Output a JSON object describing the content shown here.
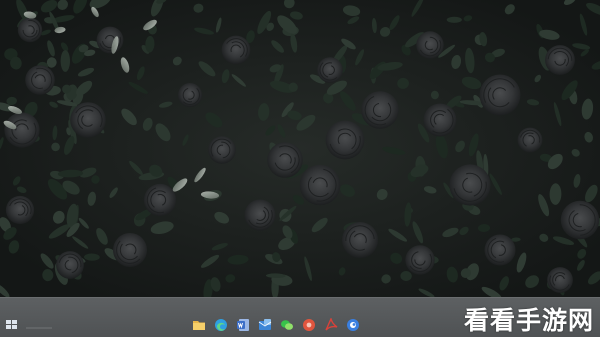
{
  "desktop": {
    "wallpaper": "dark-roses",
    "colors": {
      "foliage": "#2c3430",
      "petal": "#3a3c3e",
      "leaf_highlight": "#9aa39c",
      "taskbar": "#57595b"
    }
  },
  "taskbar": {
    "start_icon": "windows-start-icon",
    "apps": [
      {
        "name": "file-explorer",
        "icon": "folder-icon",
        "color": "#e8b64a"
      },
      {
        "name": "edge",
        "icon": "edge-icon",
        "color": "#2f9fe0"
      },
      {
        "name": "word",
        "icon": "word-icon",
        "color": "#3c6fc8"
      },
      {
        "name": "mail",
        "icon": "mail-icon",
        "color": "#3d86d6"
      },
      {
        "name": "wechat",
        "icon": "wechat-icon",
        "color": "#37c24b"
      },
      {
        "name": "app-red",
        "icon": "red-app-icon",
        "color": "#e0553e"
      },
      {
        "name": "pdf",
        "icon": "pdf-icon",
        "color": "#d9423a"
      },
      {
        "name": "app-blue",
        "icon": "blue-app-icon",
        "color": "#3a7fe0"
      }
    ]
  },
  "watermark": {
    "text": "看看手游网"
  }
}
